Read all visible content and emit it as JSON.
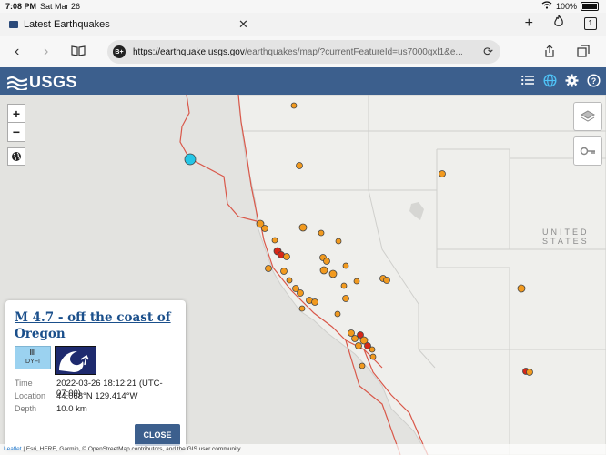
{
  "status": {
    "time": "7:08 PM",
    "date": "Sat Mar 26",
    "battery": "100%"
  },
  "tab": {
    "title": "Latest Earthquakes",
    "count": "1"
  },
  "url": {
    "host": "https://earthquake.usgs.gov",
    "path": "/earthquakes/map/?currentFeatureId=us7000gxl1&e...",
    "badge": "B+"
  },
  "header": {
    "logo": "USGS"
  },
  "map": {
    "zoom_in": "+",
    "zoom_out": "−",
    "country_label": "UNITED STATES"
  },
  "popup": {
    "title": "M 4.7 - off the coast of Oregon",
    "dyfi_level": "III",
    "dyfi_label": "DYFI",
    "time_label": "Time",
    "time_value": "2022-03-26 18:12:21 (UTC-07:00)",
    "location_label": "Location",
    "location_value": "44.068°N 129.414°W",
    "depth_label": "Depth",
    "depth_value": "10.0 km",
    "close_label": "CLOSE"
  },
  "attribution": {
    "leaflet": "Leaflet",
    "text": " | Esri, HERE, Garmin, © OpenStreetMap contributors, and the GIS user community"
  },
  "colors": {
    "header": "#3c5f8d",
    "quake_orange": "#f29a1f",
    "quake_red": "#d62718",
    "selected": "#25c6e6",
    "fault": "#d9584a"
  }
}
